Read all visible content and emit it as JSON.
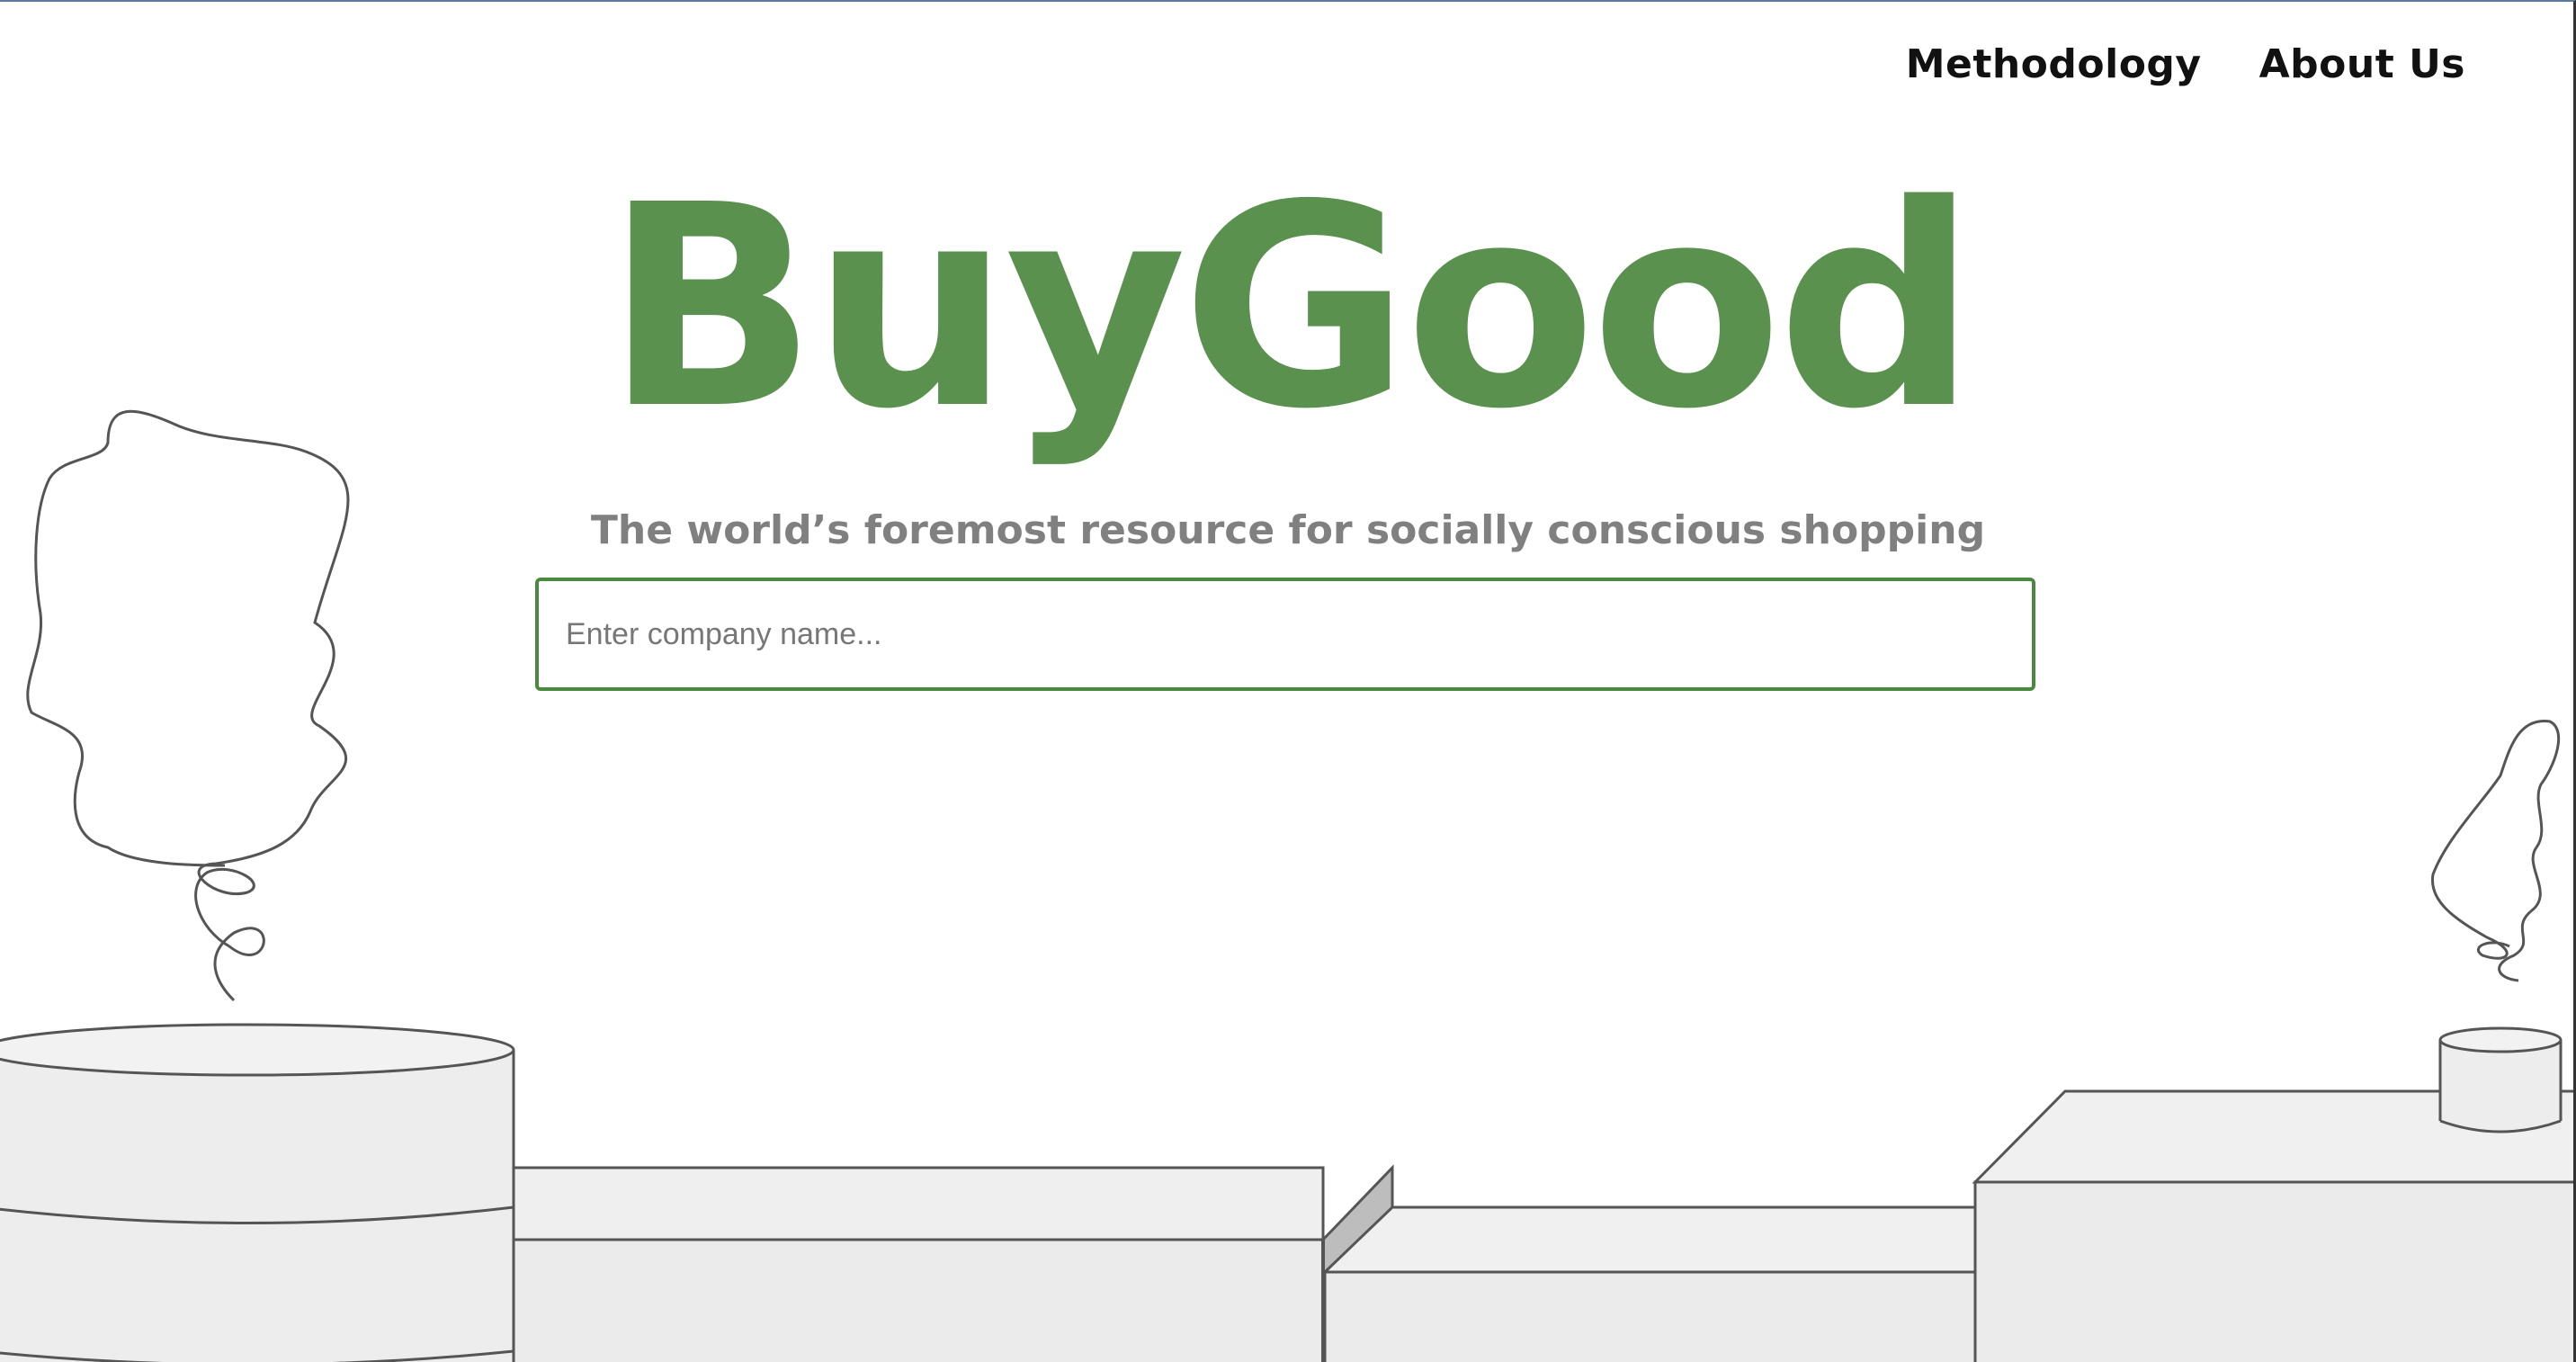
{
  "nav": {
    "items": [
      {
        "label": "Methodology"
      },
      {
        "label": "About Us"
      }
    ]
  },
  "hero": {
    "brand": "BuyGood",
    "tagline": "The world’s foremost resource for socially conscious shopping"
  },
  "search": {
    "placeholder": "Enter company name...",
    "value": ""
  },
  "colors": {
    "brand_green": "#5a914e",
    "search_border": "#4a8a3f",
    "tagline_gray": "#808080",
    "shape_fill": "#efefef",
    "shape_stroke": "#555555"
  },
  "decor": {
    "icons": [
      "smoke-plume-left",
      "smoke-plume-right",
      "cylinder-left",
      "cylinder-small-right",
      "box-platforms"
    ]
  }
}
